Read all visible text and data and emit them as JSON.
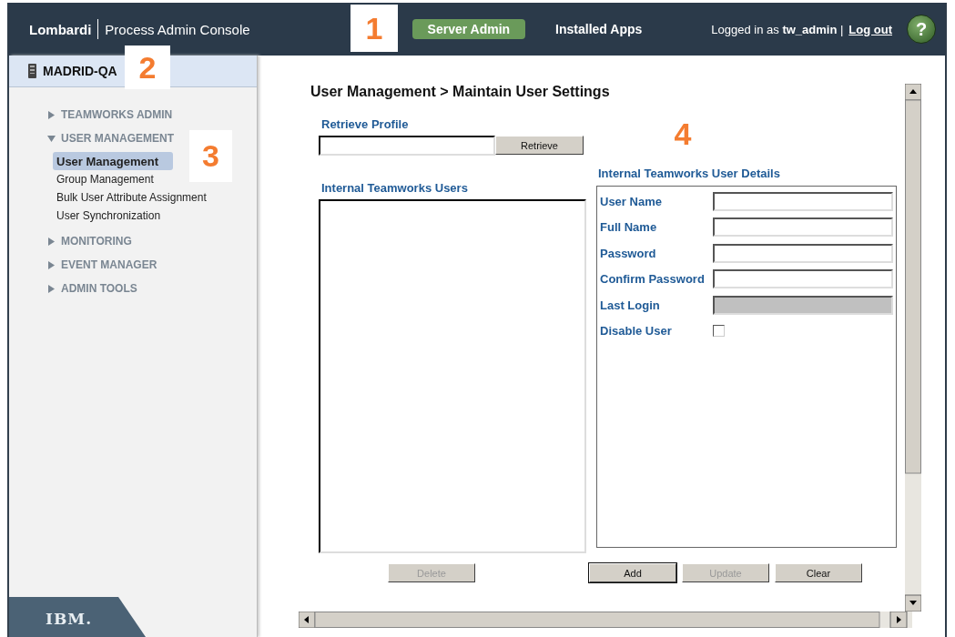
{
  "header": {
    "brand": "Lombardi",
    "product": "Process Admin Console",
    "tabs": [
      {
        "label": "Server Admin",
        "selected": true
      },
      {
        "label": "Installed Apps",
        "selected": false
      }
    ],
    "login_prefix": "Logged in as",
    "user": "tw_admin",
    "separator": "|",
    "logout": "Log out",
    "help": "?"
  },
  "sidebar": {
    "server": "MADRID-QA",
    "sections": [
      {
        "label": "TEAMWORKS ADMIN",
        "expanded": false
      },
      {
        "label": "USER MANAGEMENT",
        "expanded": true,
        "children": [
          {
            "label": "User Management",
            "selected": true
          },
          {
            "label": "Group Management",
            "selected": false
          },
          {
            "label": "Bulk User Attribute Assignment",
            "selected": false
          },
          {
            "label": "User Synchronization",
            "selected": false
          }
        ]
      },
      {
        "label": "MONITORING",
        "expanded": false
      },
      {
        "label": "EVENT MANAGER",
        "expanded": false
      },
      {
        "label": "ADMIN TOOLS",
        "expanded": false
      }
    ],
    "footer_logo": "IBM."
  },
  "content": {
    "title": "User Management > Maintain User Settings",
    "retrieve_label": "Retrieve Profile",
    "retrieve_button": "Retrieve",
    "users_label": "Internal Teamworks Users",
    "details_label": "Internal Teamworks User Details",
    "fields": [
      {
        "label": "User Name",
        "kind": "text",
        "disabled": false
      },
      {
        "label": "Full Name",
        "kind": "text",
        "disabled": false
      },
      {
        "label": "Password",
        "kind": "text",
        "disabled": false
      },
      {
        "label": "Confirm Password",
        "kind": "text",
        "disabled": false
      },
      {
        "label": "Last Login",
        "kind": "text",
        "disabled": true
      },
      {
        "label": "Disable User",
        "kind": "checkbox",
        "checked": false
      }
    ],
    "left_buttons": [
      {
        "label": "Delete",
        "disabled": true,
        "default": false
      }
    ],
    "right_buttons": [
      {
        "label": "Add",
        "disabled": false,
        "default": true
      },
      {
        "label": "Update",
        "disabled": true,
        "default": false
      },
      {
        "label": "Clear",
        "disabled": false,
        "default": false
      }
    ]
  },
  "callouts": [
    {
      "label": "1"
    },
    {
      "label": "2"
    },
    {
      "label": "3"
    },
    {
      "label": "4"
    }
  ]
}
